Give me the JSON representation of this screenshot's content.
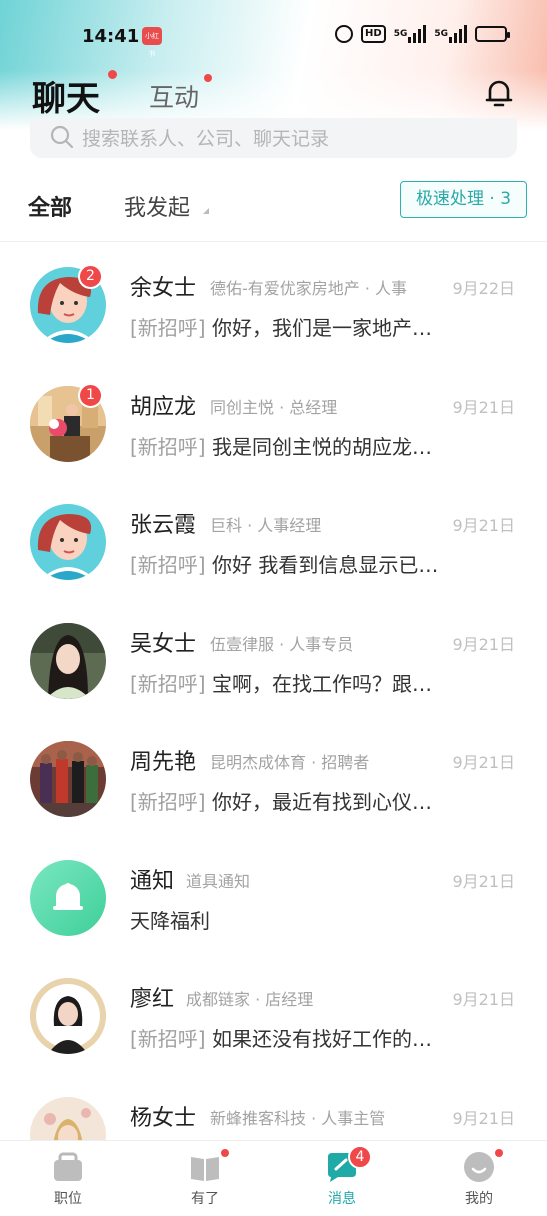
{
  "status_bar": {
    "time": "14:41",
    "app_badge": "小红书",
    "hd": "HD",
    "net1": "5G",
    "net2": "5G"
  },
  "header": {
    "tab_chat": "聊天",
    "tab_interact": "互动"
  },
  "search": {
    "placeholder": "搜索联系人、公司、聊天记录"
  },
  "filter": {
    "all": "全部",
    "mine": "我发起",
    "fast": "极速处理 · 3"
  },
  "conversations": [
    {
      "name": "余女士",
      "company": "德佑-有爱优家房地产 · 人事",
      "date": "9月22日",
      "tag": "[新招呼]",
      "message": "你好，我们是一家地产…",
      "badge": "2",
      "avatar": "cartoon-woman-avatar-icon"
    },
    {
      "name": "胡应龙",
      "company": "同创主悦 · 总经理",
      "date": "9月21日",
      "tag": "[新招呼]",
      "message": "我是同创主悦的胡应龙…",
      "badge": "1",
      "avatar": "photo-avatar"
    },
    {
      "name": "张云霞",
      "company": "巨科 · 人事经理",
      "date": "9月21日",
      "tag": "[新招呼]",
      "message": "你好 我看到信息显示已…",
      "badge": "",
      "avatar": "cartoon-woman-avatar-icon"
    },
    {
      "name": "吴女士",
      "company": "伍壹律服 · 人事专员",
      "date": "9月21日",
      "tag": "[新招呼]",
      "message": "宝啊，在找工作吗？跟…",
      "badge": "",
      "avatar": "photo-avatar"
    },
    {
      "name": "周先艳",
      "company": "昆明杰成体育 · 招聘者",
      "date": "9月21日",
      "tag": "[新招呼]",
      "message": "你好，最近有找到心仪…",
      "badge": "",
      "avatar": "photo-avatar"
    },
    {
      "name": "通知",
      "company": "道具通知",
      "date": "9月21日",
      "tag": "",
      "message": "天降福利",
      "badge": "",
      "avatar": "bell-avatar-icon"
    },
    {
      "name": "廖红",
      "company": "成都链家 · 店经理",
      "date": "9月21日",
      "tag": "[新招呼]",
      "message": "如果还没有找好工作的…",
      "badge": "",
      "avatar": "photo-avatar"
    },
    {
      "name": "杨女士",
      "company": "新蜂推客科技 · 人事主管",
      "date": "9月21日",
      "tag": "",
      "message": "",
      "badge": "",
      "avatar": "photo-avatar"
    }
  ],
  "tabbar": {
    "items": [
      {
        "label": "职位",
        "icon": "briefcase-icon"
      },
      {
        "label": "有了",
        "icon": "book-icon"
      },
      {
        "label": "消息",
        "icon": "message-icon",
        "badge": "4"
      },
      {
        "label": "我的",
        "icon": "profile-icon"
      }
    ]
  },
  "colors": {
    "accent": "#1fa9a7",
    "badge": "#f04848"
  }
}
